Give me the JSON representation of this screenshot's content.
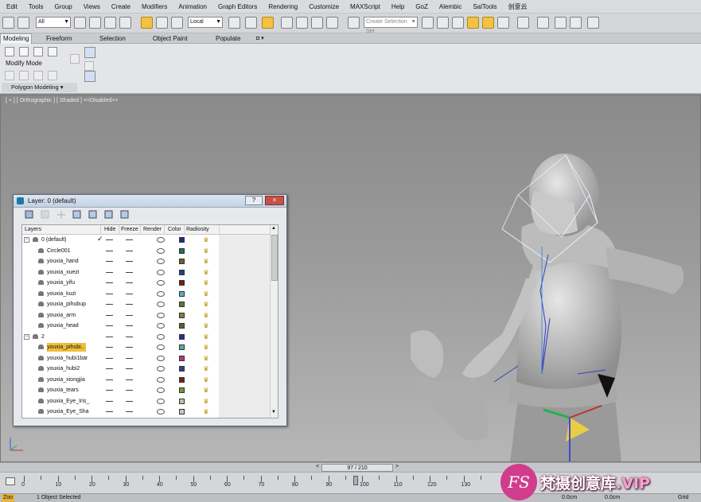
{
  "menu": [
    "Edit",
    "Tools",
    "Group",
    "Views",
    "Create",
    "Modifiers",
    "Animation",
    "Graph Editors",
    "Rendering",
    "Customize",
    "MAXScript",
    "Help",
    "GoZ",
    "Alembic",
    "SalTools",
    "创意云"
  ],
  "toolbar": {
    "selection_filter": "All",
    "ref_coord": "Local",
    "named_selection_placeholder": "Create Selection Set"
  },
  "ribbon_tabs": [
    "Modeling",
    "Freeform",
    "Selection",
    "Object Paint",
    "Populate"
  ],
  "ribbon": {
    "modify_mode": "Modify Mode",
    "polygon_modeling": "Polygon Modeling"
  },
  "viewport": {
    "label": "[ + ] [ Orthographic ] [ Shaded ]  <<Disabled>>"
  },
  "layer_dialog": {
    "title": "Layer: 0 (default)",
    "help_btn": "?",
    "close_btn": "×",
    "columns": [
      "Layers",
      "Hide",
      "Freeze",
      "Render",
      "Color",
      "Radiosity"
    ],
    "rows": [
      {
        "name": "0 (default)",
        "level": 0,
        "expander": "−",
        "active": true,
        "color": "#232a8c"
      },
      {
        "name": "Circle001",
        "level": 1,
        "color": "#1f6f5f"
      },
      {
        "name": "youxia_hand",
        "level": 1,
        "color": "#7a5a28"
      },
      {
        "name": "youxia_xuezi",
        "level": 1,
        "color": "#26408a"
      },
      {
        "name": "youxia_yifu",
        "level": 1,
        "color": "#7d1a1a"
      },
      {
        "name": "youxia_kuzi",
        "level": 1,
        "color": "#4fb3c9"
      },
      {
        "name": "youxia_pihubup",
        "level": 1,
        "color": "#5a7a2a"
      },
      {
        "name": "youxia_arm",
        "level": 1,
        "color": "#8a7a2e"
      },
      {
        "name": "youxia_head",
        "level": 1,
        "color": "#4e6a2a"
      },
      {
        "name": "2",
        "level": 0,
        "expander": "−",
        "color": "#2a2f8f"
      },
      {
        "name": "youxia_pihubi..",
        "level": 1,
        "selected": true,
        "color": "#4fb39a"
      },
      {
        "name": "youxia_hubi1bar",
        "level": 1,
        "color": "#b33a7c"
      },
      {
        "name": "youxia_hubi2",
        "level": 1,
        "color": "#2e3f9a"
      },
      {
        "name": "youxia_xiongjia",
        "level": 1,
        "color": "#7a1d1d"
      },
      {
        "name": "youxia_tears",
        "level": 1,
        "color": "#6f9a2a"
      },
      {
        "name": "youxia_Eye_Iris_",
        "level": 1,
        "color": "#b7c7a4"
      },
      {
        "name": "youxia_Eye_Sha",
        "level": 1,
        "color": "#c9c9c9"
      }
    ]
  },
  "timeline": {
    "frame_counter": "97 / 210",
    "ticks": [
      "0",
      "10",
      "20",
      "30",
      "40",
      "50",
      "60",
      "70",
      "80",
      "90",
      "100",
      "110",
      "120",
      "130"
    ]
  },
  "status": {
    "selection": "1 Object Selected",
    "zoom_label": "Zoo",
    "x_val": "0.0cm",
    "y_val": "0.0cm",
    "grid": "Grid"
  },
  "watermark": {
    "logo": "FS",
    "text": "梵摄创意库",
    "vip": ".VIP"
  }
}
